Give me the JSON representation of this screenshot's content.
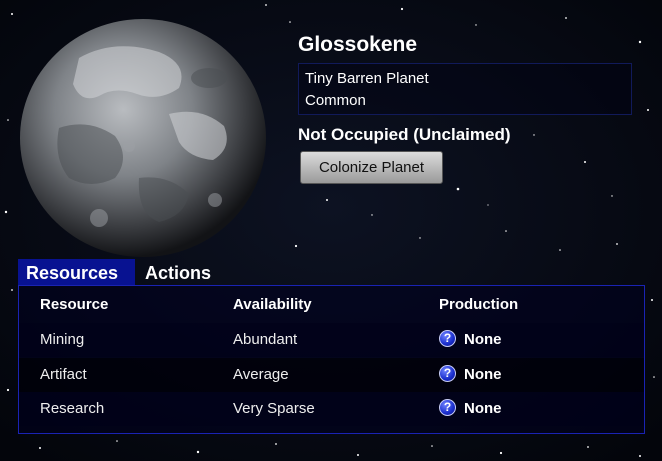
{
  "planet": {
    "name": "Glossokene",
    "type": "Tiny Barren Planet",
    "rarity": "Common",
    "status": "Not Occupied (Unclaimed)",
    "colonize_label": "Colonize Planet",
    "image_icon": "planet-image"
  },
  "tabs": [
    {
      "label": "Resources",
      "active": true
    },
    {
      "label": "Actions",
      "active": false
    }
  ],
  "resources_table": {
    "headers": [
      "Resource",
      "Availability",
      "Production"
    ],
    "rows": [
      {
        "resource": "Mining",
        "availability": "Abundant",
        "production": "None"
      },
      {
        "resource": "Artifact",
        "availability": "Average",
        "production": "None"
      },
      {
        "resource": "Research",
        "availability": "Very Sparse",
        "production": "None"
      }
    ],
    "help_icon_glyph": "?"
  },
  "colors": {
    "background": "#04070f",
    "active_tab": "#081291",
    "panel_border": "#1a23b3",
    "help_icon": "#1a2ecc"
  }
}
